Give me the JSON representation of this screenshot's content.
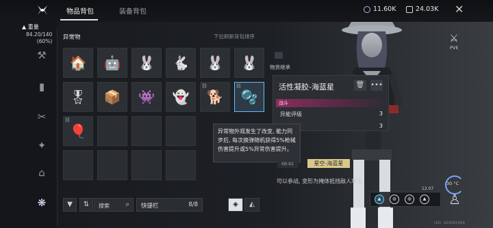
{
  "tabs": [
    {
      "label": "物品背包",
      "active": true
    },
    {
      "label": "装备背包",
      "active": false
    }
  ],
  "currencies": [
    {
      "icon": "energy-icon",
      "value": "11.60K"
    },
    {
      "icon": "chip-icon",
      "value": "24.03K"
    }
  ],
  "weight": {
    "label": "重量",
    "value": "84.20/140",
    "percent": "(60%)"
  },
  "section": {
    "title": "异常物",
    "hint": "下拉刷新背包排序"
  },
  "inherit_label": "物资继承",
  "detail": {
    "title": "活性凝胶-海蓝星",
    "tag": "战斗",
    "stats": [
      {
        "label": "异能评级",
        "value": "3"
      },
      {
        "label": "",
        "value": "3"
      }
    ]
  },
  "tooltip": {
    "text": "异常物外观发生了改变, 能力同步后, 每次换弹随机获得5%枪械伤害提升或5%异常伤害提升。"
  },
  "secondary": {
    "tag": "KB-82",
    "name": "星空-海蓝星",
    "desc": "可以参战, 变形为掩体抵挡敌人攻击"
  },
  "toolbar": {
    "search_label": "搜索",
    "quickbar_label": "快捷栏",
    "quickbar_count": "8/8"
  },
  "right_panel": {
    "mode_label": "PVE",
    "temperature": "30 °C",
    "small_value": "12.07"
  },
  "uid": "UID: 162681568",
  "items": [
    {
      "name": "snow-cabin",
      "icon": "🏠",
      "color": "#c45a4a"
    },
    {
      "name": "robot-figure",
      "icon": "🤖",
      "color": "#9a9a9a"
    },
    {
      "name": "bunny-doll",
      "icon": "🐰",
      "color": "#e7c9b0"
    },
    {
      "name": "black-bunny-doll",
      "icon": "🐇",
      "color": "#444"
    },
    {
      "name": "bunny-doll-2",
      "icon": "🐰",
      "color": "#e7c9b0"
    },
    {
      "name": "bunny-doll-3",
      "icon": "🐰",
      "color": "#e7c9b0"
    },
    {
      "name": "soldier-figure",
      "icon": "🎖",
      "color": "#b44"
    },
    {
      "name": "box-robot",
      "icon": "📦",
      "color": "#ccc"
    },
    {
      "name": "gremlin-toy",
      "icon": "👾",
      "color": "#ddd"
    },
    {
      "name": "white-doll",
      "icon": "👻",
      "color": "#eee"
    },
    {
      "name": "guard-dog",
      "icon": "🐕",
      "color": "#553"
    },
    {
      "name": "blue-jelly",
      "icon": "🫧",
      "color": "#4f6fa8"
    },
    {
      "name": "balloon-dog",
      "icon": "🎈",
      "color": "#e56a73"
    }
  ]
}
